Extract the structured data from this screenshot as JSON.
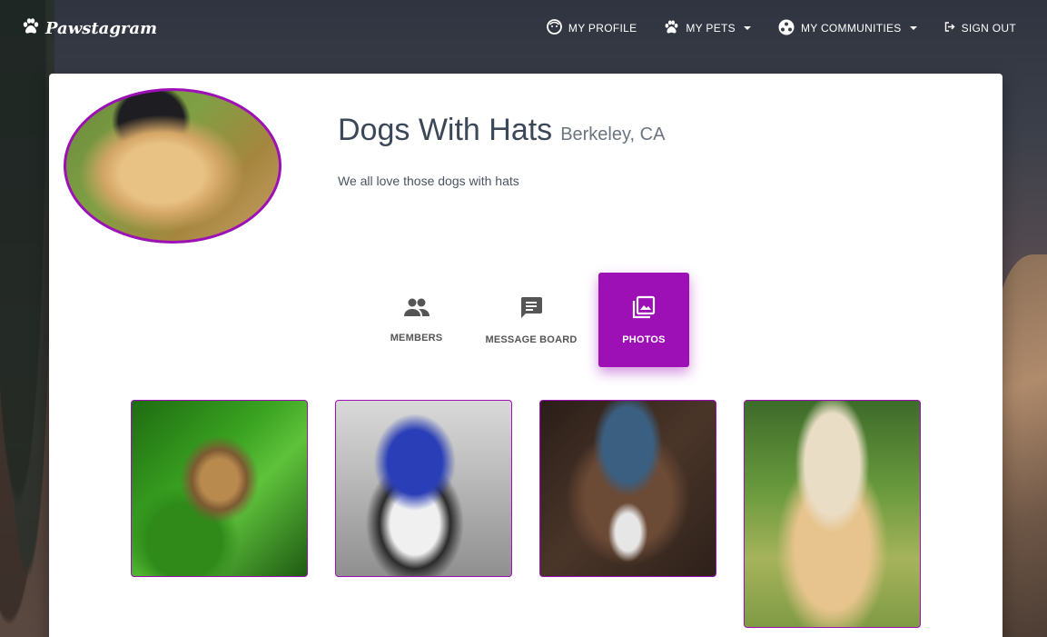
{
  "navbar": {
    "brand": "Pawstagram",
    "items": [
      {
        "label": "MY PROFILE",
        "icon": "face-icon"
      },
      {
        "label": "MY PETS",
        "icon": "paw-icon"
      },
      {
        "label": "MY COMMUNITIES",
        "icon": "community-icon"
      },
      {
        "label": "SIGN OUT",
        "icon": "sign-out-icon"
      }
    ]
  },
  "community": {
    "name": "Dogs With Hats",
    "location": "Berkeley, CA",
    "description": "We all love those dogs with hats"
  },
  "tabs": [
    {
      "label": "MEMBERS",
      "icon": "members-icon"
    },
    {
      "label": "MESSAGE BOARD",
      "icon": "message-icon"
    },
    {
      "label": "PHOTOS",
      "icon": "photos-icon",
      "active": true
    }
  ],
  "colors": {
    "accent": "#9c10b5",
    "title": "#3c4858"
  }
}
